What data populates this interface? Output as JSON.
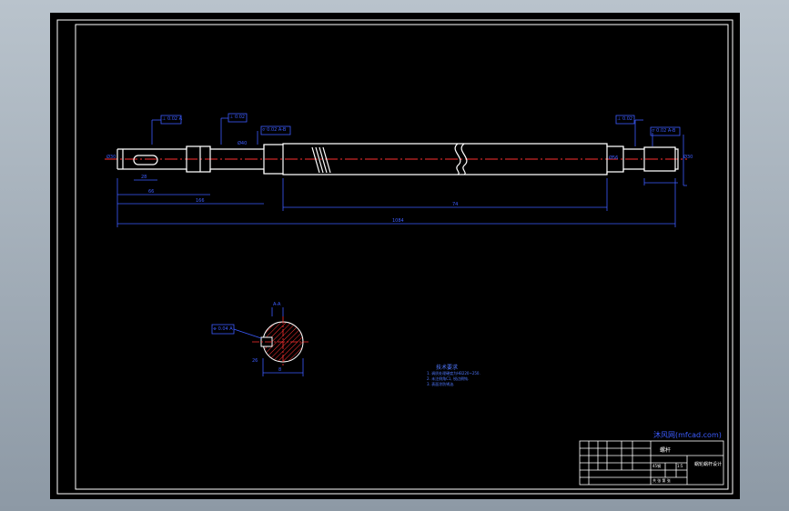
{
  "colors": {
    "background": "#000000",
    "frame": "#ffffff",
    "dimension": "#3c5cff",
    "centerline": "#ff3030",
    "hatch": "#ff3030",
    "note": "#5078ff"
  },
  "drawing": {
    "tolerance_frames": [
      "⊥ 0.02 A",
      "⊥ 0.02",
      "⌭ 0.02 A-B",
      "⊥ 0.02",
      "⌭ 0.02 A-B",
      "⌭ 0.02 A-B"
    ],
    "dimensions": {
      "keyway_len": "28",
      "seg1": "66",
      "seg2": "166",
      "long_span": "74",
      "overall": "1084",
      "d_left": "Ø30",
      "d_right": "Ø30",
      "d_mid": "Ø40",
      "d_body": "Ø56"
    },
    "section": {
      "label": "A-A",
      "width_dim": "8",
      "depth_dim": "26",
      "frame": "⌯ 0.04 A"
    },
    "tech_requirements": {
      "heading": "技术要求",
      "lines": [
        "1. 调质处理硬度为HB220~250.",
        "2. 未注倒角C1, 锐边倒钝.",
        "3. 表面涂防锈油."
      ]
    }
  },
  "title_block": {
    "watermark": "沐风网(mfcad.com)",
    "part_name": "螺杆",
    "drawing_no": "蜗轮蜗杆设计",
    "material": "45钢",
    "scale": "1:5",
    "sheet_info": "共 张 第 张"
  }
}
